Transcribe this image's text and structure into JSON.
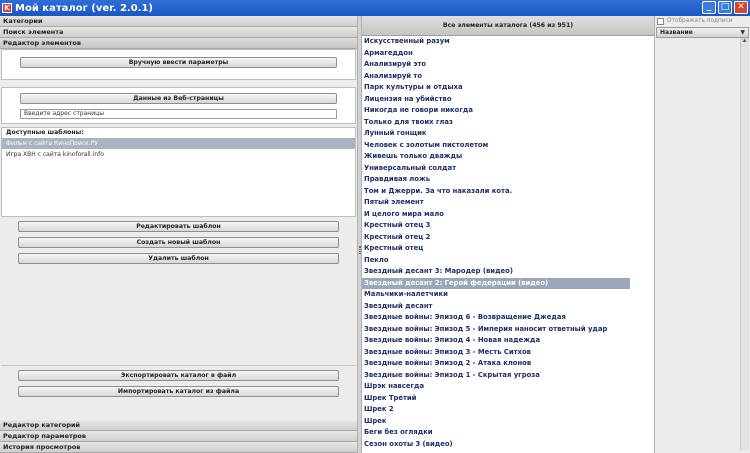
{
  "window": {
    "title": "Мой каталог (ver. 2.0.1)",
    "app_icon": "K",
    "controls": [
      "_",
      "□",
      "✕"
    ]
  },
  "left": {
    "headers": {
      "categories": "Категории",
      "search": "Поиск элемента",
      "editor": "Редактор элементов",
      "category_editor": "Редактор категорий",
      "param_editor": "Редактор параметров",
      "history": "История просмотров"
    },
    "manual_button": "Вручную ввести параметры",
    "web_button": "Данные из Веб-страницы",
    "url_placeholder": "Введите адрес страницы",
    "templates_label": "Доступные шаблоны:",
    "templates": [
      "Фильм с сайта КиноПоиск.РУ",
      "Игра XBH с сайта kinoforall.info"
    ],
    "edit_template_button": "Редактировать шаблон",
    "new_template_button": "Создать новый шаблон",
    "delete_template_button": "Удалить шаблон",
    "export_button": "Экспортировать каталог в файл",
    "import_button": "Импортировать каталог из файла"
  },
  "right": {
    "header": "Все элементы каталога (456 из 951)",
    "items": [
      "Искусственный разум",
      "Армагеддон",
      "Анализируй это",
      "Анализируй то",
      "Парк культуры и отдыха",
      "Лицензия на убийство",
      "Никогда не говори никогда",
      "Только для твоих глаз",
      "Лунный гонщик",
      "Человек с золотым пистолетом",
      "Живешь только дважды",
      "Универсальный солдат",
      "Правдивая ложь",
      "Том и Джерри. За что наказали кота.",
      "Пятый элемент",
      "И целого мира мало",
      "Крестный отец 3",
      "Крестный отец 2",
      "Крестный отец",
      "Пекло",
      "Звездный десант 3: Мародер (видео)",
      "Звездный десант 2: Герой федерации (видео)",
      "Мальчики-налетчики",
      "Звездный десант",
      "Звездные войны: Эпизод 6 - Возвращение Джедая",
      "Звездные войны: Эпизод 5 - Империя наносит ответный удар",
      "Звездные войны: Эпизод 4 - Новая надежда",
      "Звездные войны: Эпизод 3 - Месть Ситхов",
      "Звездные войны: Эпизод 2 - Атака клонов",
      "Звездные войны: Эпизод 1 - Скрытая угроза",
      "Шрэк навсегда",
      "Шрек Третий",
      "Шрек 2",
      "Шрек",
      "Беги без оглядки",
      "Сезон охоты 3 (видео)"
    ],
    "selected_index": 21
  },
  "side": {
    "show_images_label": "Отображать подписи",
    "sort_select": "Название"
  }
}
